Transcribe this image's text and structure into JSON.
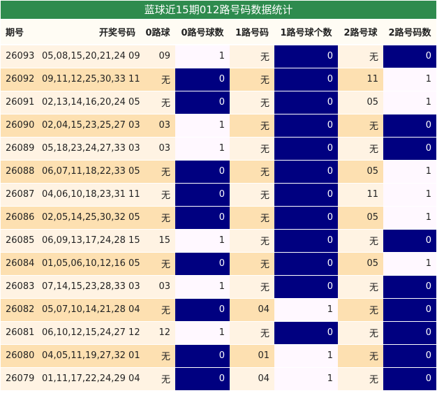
{
  "title": "蓝球近15期012路号码数据统计",
  "columns": [
    "期号",
    "开奖号码",
    "0路球",
    "0路号球数",
    "1路号码",
    "1路号球个数",
    "2路号球",
    "2路号码数"
  ],
  "rows": [
    {
      "period": "26093",
      "numbers": "05,08,15,20,21,24 09",
      "r0_ball": "09",
      "r0_count": "1",
      "r1_num": "无",
      "r1_count": "0",
      "r2_ball": "无",
      "r2_count": "0"
    },
    {
      "period": "26092",
      "numbers": "09,11,12,25,30,33 11",
      "r0_ball": "无",
      "r0_count": "0",
      "r1_num": "无",
      "r1_count": "0",
      "r2_ball": "11",
      "r2_count": "1"
    },
    {
      "period": "26091",
      "numbers": "02,13,14,16,20,24 05",
      "r0_ball": "无",
      "r0_count": "0",
      "r1_num": "无",
      "r1_count": "0",
      "r2_ball": "05",
      "r2_count": "1"
    },
    {
      "period": "26090",
      "numbers": "02,04,15,23,25,27 03",
      "r0_ball": "03",
      "r0_count": "1",
      "r1_num": "无",
      "r1_count": "0",
      "r2_ball": "无",
      "r2_count": "0"
    },
    {
      "period": "26089",
      "numbers": "05,18,23,24,27,33 03",
      "r0_ball": "03",
      "r0_count": "1",
      "r1_num": "无",
      "r1_count": "0",
      "r2_ball": "无",
      "r2_count": "0"
    },
    {
      "period": "26088",
      "numbers": "06,07,11,18,22,33 05",
      "r0_ball": "无",
      "r0_count": "0",
      "r1_num": "无",
      "r1_count": "0",
      "r2_ball": "05",
      "r2_count": "1"
    },
    {
      "period": "26087",
      "numbers": "04,06,10,18,23,31 11",
      "r0_ball": "无",
      "r0_count": "0",
      "r1_num": "无",
      "r1_count": "0",
      "r2_ball": "11",
      "r2_count": "1"
    },
    {
      "period": "26086",
      "numbers": "02,05,14,25,30,32 05",
      "r0_ball": "无",
      "r0_count": "0",
      "r1_num": "无",
      "r1_count": "0",
      "r2_ball": "05",
      "r2_count": "1"
    },
    {
      "period": "26085",
      "numbers": "06,09,13,17,24,28 15",
      "r0_ball": "15",
      "r0_count": "1",
      "r1_num": "无",
      "r1_count": "0",
      "r2_ball": "无",
      "r2_count": "0"
    },
    {
      "period": "26084",
      "numbers": "01,05,06,10,12,16 05",
      "r0_ball": "无",
      "r0_count": "0",
      "r1_num": "无",
      "r1_count": "0",
      "r2_ball": "05",
      "r2_count": "1"
    },
    {
      "period": "26083",
      "numbers": "07,14,15,23,28,33 03",
      "r0_ball": "03",
      "r0_count": "1",
      "r1_num": "无",
      "r1_count": "0",
      "r2_ball": "无",
      "r2_count": "0"
    },
    {
      "period": "26082",
      "numbers": "05,07,10,14,21,28 04",
      "r0_ball": "无",
      "r0_count": "0",
      "r1_num": "04",
      "r1_count": "1",
      "r2_ball": "无",
      "r2_count": "0"
    },
    {
      "period": "26081",
      "numbers": "06,10,12,15,24,27 12",
      "r0_ball": "12",
      "r0_count": "1",
      "r1_num": "无",
      "r1_count": "0",
      "r2_ball": "无",
      "r2_count": "0"
    },
    {
      "period": "26080",
      "numbers": "04,05,11,19,27,32 01",
      "r0_ball": "无",
      "r0_count": "0",
      "r1_num": "01",
      "r1_count": "1",
      "r2_ball": "无",
      "r2_count": "0"
    },
    {
      "period": "26079",
      "numbers": "01,11,17,22,24,29 04",
      "r0_ball": "无",
      "r0_count": "0",
      "r1_num": "04",
      "r1_count": "1",
      "r2_ball": "无",
      "r2_count": "0"
    }
  ],
  "colors": {
    "title_bg": "#2e8b4e",
    "highlight_zero": "#000080",
    "row_light": "#fff3e3",
    "row_dark": "#fde0b1",
    "count_one": "#fff8ff"
  }
}
